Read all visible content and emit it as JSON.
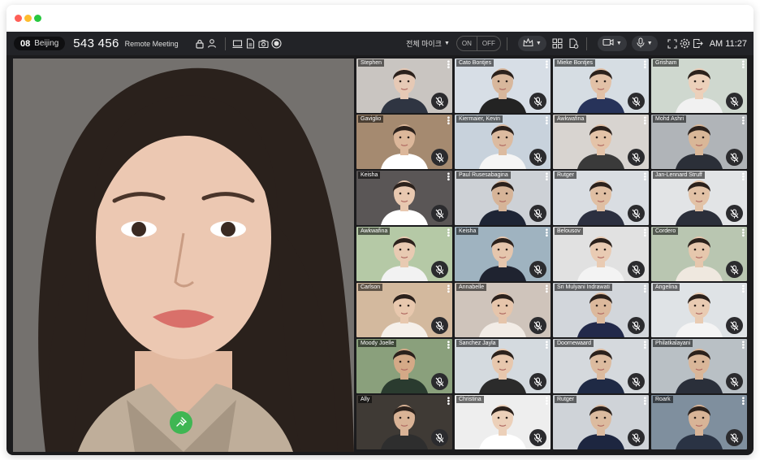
{
  "window": {
    "controls": [
      "close",
      "minimize",
      "maximize"
    ]
  },
  "toolbar": {
    "room_number": "08",
    "location": "Beijing",
    "meeting_id": "543 456",
    "meeting_title": "Remote Meeting",
    "mic_all_label": "전체 마이크",
    "toggle_on": "ON",
    "toggle_off": "OFF",
    "clock": "AM 11:27",
    "icons": [
      "lock-icon",
      "participants-icon",
      "screen-share-icon",
      "document-icon",
      "camera-icon",
      "record-icon",
      "crown-icon",
      "layout-icon",
      "file-share-icon",
      "video-icon",
      "mic-icon",
      "fullscreen-icon",
      "settings-icon",
      "exit-icon"
    ]
  },
  "main_speaker": {
    "pin_icon": "pin-icon"
  },
  "participants": [
    {
      "name": "Stephen",
      "tone": "#e6c9b5",
      "bg": "#c9c5c1",
      "shirt": "#2f3542"
    },
    {
      "name": "Cato Bontjes",
      "tone": "#d8b79c",
      "bg": "#d7dee6",
      "shirt": "#232323"
    },
    {
      "name": "Mieke Bontjes",
      "tone": "#e2c1a7",
      "bg": "#d6dde3",
      "shirt": "#27335a"
    },
    {
      "name": "Grisham",
      "tone": "#ecd0ba",
      "bg": "#cfd8cf",
      "shirt": "#f1f1f1"
    },
    {
      "name": "Gaviglio",
      "tone": "#dcb79a",
      "bg": "#a58a70",
      "shirt": "#ffffff"
    },
    {
      "name": "Kiermaier, Kevin",
      "tone": "#dcbba0",
      "bg": "#c8d2dc",
      "shirt": "#f5f5f5"
    },
    {
      "name": "Awkwafina",
      "tone": "#e4c3a8",
      "bg": "#d8d4d0",
      "shirt": "#3a3a3a"
    },
    {
      "name": "Mohd Ashri",
      "tone": "#d9b798",
      "bg": "#b0b4b8",
      "shirt": "#2b2f38"
    },
    {
      "name": "Keisha",
      "tone": "#e8c8b0",
      "bg": "#5a5656",
      "shirt": "#ffffff"
    },
    {
      "name": "Paul Rusesabagina",
      "tone": "#d6b498",
      "bg": "#cdd1d6",
      "shirt": "#1e2535"
    },
    {
      "name": "Rutger",
      "tone": "#e0bfa3",
      "bg": "#d9dde2",
      "shirt": "#2c3040"
    },
    {
      "name": "Jan-Lennard Struff",
      "tone": "#e2c2a6",
      "bg": "#e2e4e6",
      "shirt": "#2b2f3a"
    },
    {
      "name": "Awkwafina",
      "tone": "#e8cab2",
      "bg": "#b5c9a6",
      "shirt": "#f2f2f2"
    },
    {
      "name": "Keisha",
      "tone": "#e5c6ad",
      "bg": "#9fb3c0",
      "shirt": "#1f2330"
    },
    {
      "name": "Belousov",
      "tone": "#e9cbb3",
      "bg": "#e1e1e1",
      "shirt": "#f3f3f3"
    },
    {
      "name": "Cordero",
      "tone": "#e6c7ad",
      "bg": "#b9c6b1",
      "shirt": "#efe8df"
    },
    {
      "name": "Carlson",
      "tone": "#e8c8ae",
      "bg": "#d3b99e",
      "shirt": "#f5f0ea"
    },
    {
      "name": "Annabelle",
      "tone": "#e6c5ab",
      "bg": "#cfc4bb",
      "shirt": "#f2ece6"
    },
    {
      "name": "Sri Mulyani Indrawati",
      "tone": "#dcb99c",
      "bg": "#d2d6db",
      "shirt": "#22294a"
    },
    {
      "name": "Angelina",
      "tone": "#e9cbb2",
      "bg": "#dfe3e6",
      "shirt": "#f4f4f4"
    },
    {
      "name": "Moody Joelle",
      "tone": "#d4a987",
      "bg": "#8aa07c",
      "shirt": "#2a3b2f"
    },
    {
      "name": "Sanchez Jayla",
      "tone": "#e7c7ad",
      "bg": "#d4dadf",
      "shirt": "#2b2b2b"
    },
    {
      "name": "Doornewaard",
      "tone": "#dcbb9f",
      "bg": "#d5d9dd",
      "shirt": "#1f2a45"
    },
    {
      "name": "Philatkalayani",
      "tone": "#d9b699",
      "bg": "#b9c0c5",
      "shirt": "#2a2f3a"
    },
    {
      "name": "Ally",
      "tone": "#d9b396",
      "bg": "#3f3a35",
      "shirt": "#2e2e2e"
    },
    {
      "name": "Christina",
      "tone": "#ecd0b9",
      "bg": "#eeeeee",
      "shirt": "#ffffff"
    },
    {
      "name": "Rutger",
      "tone": "#dcbb9f",
      "bg": "#cfd3d8",
      "shirt": "#1d2640"
    },
    {
      "name": "Roark",
      "tone": "#d8b497",
      "bg": "#7f8f9e",
      "shirt": "#2a3344"
    }
  ]
}
